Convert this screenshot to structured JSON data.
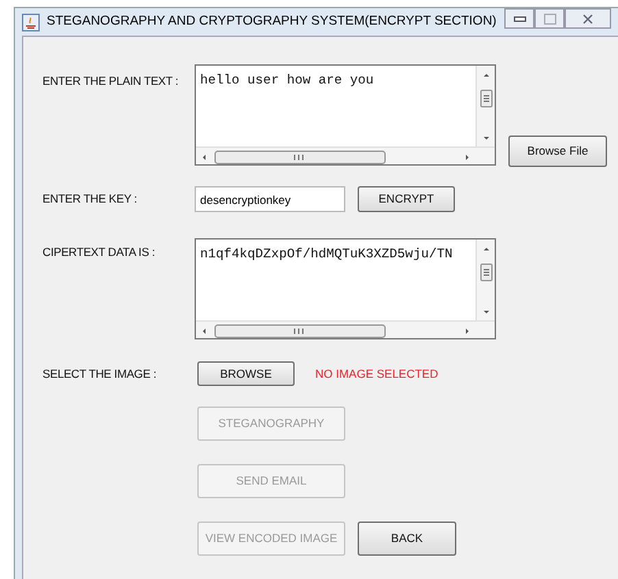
{
  "window": {
    "title": "STEGANOGRAPHY AND CRYPTOGRAPHY SYSTEM(ENCRYPT SECTION)"
  },
  "plain_text": {
    "label": "ENTER THE PLAIN TEXT :",
    "value": "hello user how are you"
  },
  "browse_file_button": {
    "label": "Browse File",
    "disabled": false
  },
  "key": {
    "label": "ENTER THE KEY :",
    "value": "desencryptionkey"
  },
  "encrypt_button": {
    "label": "ENCRYPT",
    "disabled": false
  },
  "ciphertext": {
    "label": "CIPERTEXT DATA IS :",
    "value": "n1qf4kqDZxpOf/hdMQTuK3XZD5wju/TN"
  },
  "image": {
    "label": "SELECT THE IMAGE :",
    "status": "NO IMAGE SELECTED"
  },
  "browse_button": {
    "label": "BROWSE",
    "disabled": false
  },
  "action_buttons": [
    {
      "label": "STEGANOGRAPHY",
      "disabled": true
    },
    {
      "label": "SEND EMAIL",
      "disabled": true
    },
    {
      "label": "VIEW ENCODED IMAGE",
      "disabled": true
    },
    {
      "label": "BACK",
      "disabled": false
    }
  ]
}
